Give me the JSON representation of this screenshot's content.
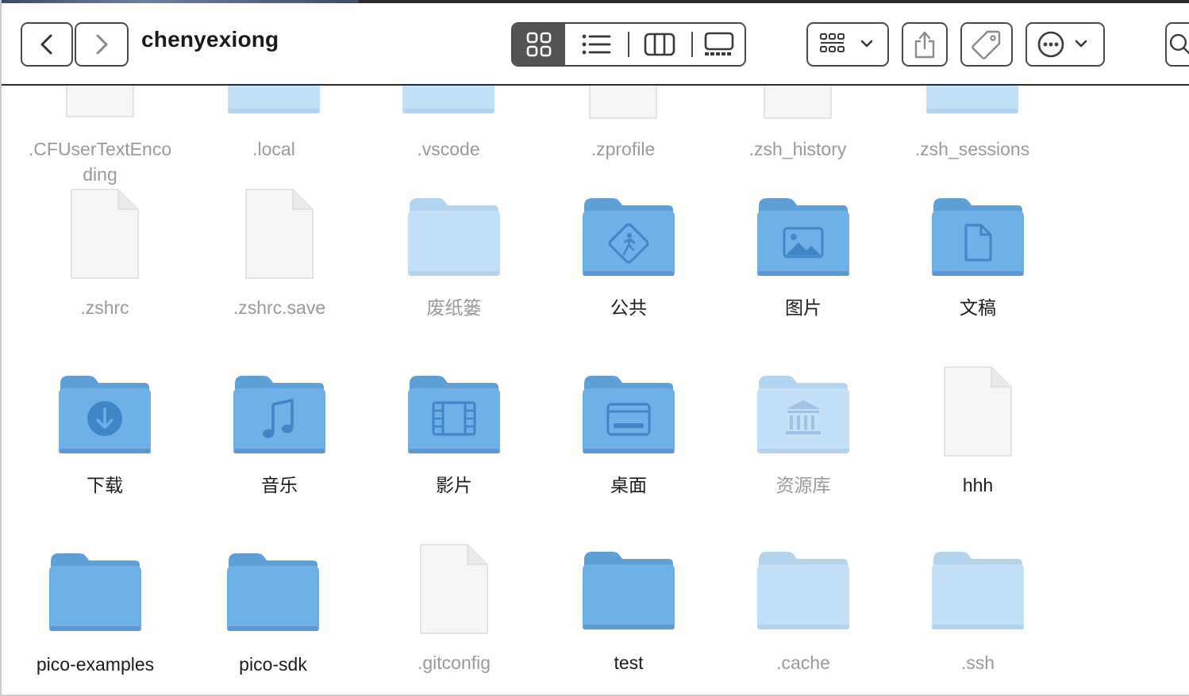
{
  "window": {
    "title": "chenyexiong"
  },
  "toolbar": {
    "back_icon": "chevron-left-icon",
    "forward_icon": "chevron-right-icon",
    "view_modes": [
      {
        "name": "icon-view",
        "icon": "grid-icon",
        "active": true
      },
      {
        "name": "list-view",
        "icon": "list-icon",
        "active": false
      },
      {
        "name": "column-view",
        "icon": "columns-icon",
        "active": false
      },
      {
        "name": "gallery-view",
        "icon": "gallery-icon",
        "active": false
      }
    ],
    "group_icon": "group-grid-icon",
    "share_icon": "share-icon",
    "tag_icon": "tag-icon",
    "more_icon": "ellipsis-circle-icon",
    "search_icon": "search-icon"
  },
  "colors": {
    "folder_front": "#6fb0e6",
    "folder_back": "#5e9fd8",
    "folder_dim_front": "#c3e0f6",
    "folder_dim_back": "#b3d4ef",
    "file_page": "#f7f7f7",
    "label_text": "#1c1c1c",
    "dim_text": "#9a9a9a"
  },
  "files": [
    {
      "name": ".CFUserTextEnco",
      "name2": "ding",
      "kind": "file",
      "dim": true
    },
    {
      "name": ".local",
      "kind": "folder",
      "dim": true
    },
    {
      "name": ".vscode",
      "kind": "folder",
      "dim": true
    },
    {
      "name": ".zprofile",
      "kind": "file",
      "dim": true
    },
    {
      "name": ".zsh_history",
      "kind": "file",
      "dim": true
    },
    {
      "name": ".zsh_sessions",
      "kind": "folder",
      "dim": true
    },
    {
      "name": ".zshrc",
      "kind": "file",
      "dim": true
    },
    {
      "name": ".zshrc.save",
      "kind": "file",
      "dim": true
    },
    {
      "name": "废纸篓",
      "kind": "folder",
      "dim": true
    },
    {
      "name": "公共",
      "kind": "folder-public",
      "dim": false
    },
    {
      "name": "图片",
      "kind": "folder-pictures",
      "dim": false
    },
    {
      "name": "文稿",
      "kind": "folder-documents",
      "dim": false
    },
    {
      "name": "下载",
      "kind": "folder-downloads",
      "dim": false
    },
    {
      "name": "音乐",
      "kind": "folder-music",
      "dim": false
    },
    {
      "name": "影片",
      "kind": "folder-movies",
      "dim": false
    },
    {
      "name": "桌面",
      "kind": "folder-desktop",
      "dim": false
    },
    {
      "name": "资源库",
      "kind": "folder-library",
      "dim": true
    },
    {
      "name": "hhh",
      "kind": "file",
      "dim": false
    },
    {
      "name": "pico-examples",
      "kind": "folder",
      "dim": false
    },
    {
      "name": "pico-sdk",
      "kind": "folder",
      "dim": false
    },
    {
      "name": ".gitconfig",
      "kind": "file",
      "dim": true
    },
    {
      "name": "test",
      "kind": "folder",
      "dim": false
    },
    {
      "name": ".cache",
      "kind": "folder",
      "dim": true
    },
    {
      "name": ".ssh",
      "kind": "folder",
      "dim": true
    }
  ]
}
